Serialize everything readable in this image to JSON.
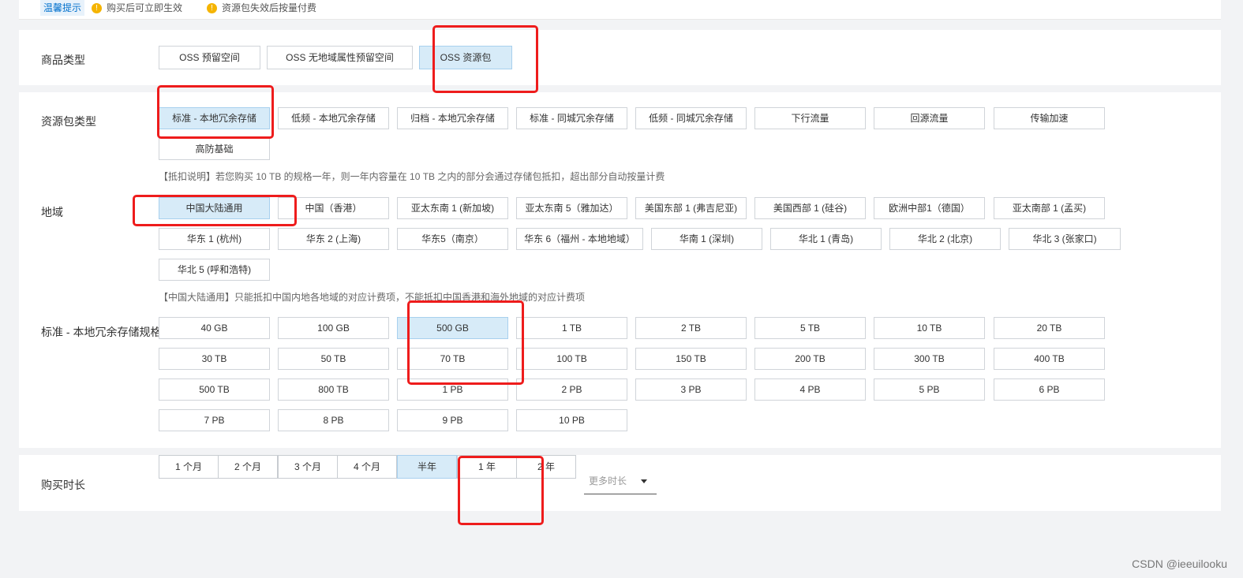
{
  "tips": {
    "tag": "温馨提示",
    "items": [
      "购买后可立即生效",
      "资源包失效后按量付费"
    ]
  },
  "product_type": {
    "label": "商品类型",
    "options": [
      "OSS 预留空间",
      "OSS 无地域属性预留空间",
      "OSS 资源包"
    ],
    "selected": "OSS 资源包"
  },
  "package_type": {
    "label": "资源包类型",
    "options": [
      "标准 - 本地冗余存储",
      "低频 - 本地冗余存储",
      "归档 - 本地冗余存储",
      "标准 - 同城冗余存储",
      "低频 - 同城冗余存储",
      "下行流量",
      "回源流量",
      "传输加速",
      "高防基础"
    ],
    "selected": "标准 - 本地冗余存储",
    "note": "【抵扣说明】若您购买 10 TB 的规格一年，则一年内容量在 10 TB 之内的部分会通过存储包抵扣，超出部分自动按量计费"
  },
  "region": {
    "label": "地域",
    "options": [
      "中国大陆通用",
      "中国（香港）",
      "亚太东南 1 (新加坡)",
      "亚太东南 5（雅加达）",
      "美国东部 1 (弗吉尼亚)",
      "美国西部 1 (硅谷)",
      "欧洲中部1（德国）",
      "亚太南部 1 (孟买)",
      "华东 1 (杭州)",
      "华东 2 (上海)",
      "华东5（南京）",
      "华东 6（福州 - 本地地域）",
      "华南 1 (深圳)",
      "华北 1 (青岛)",
      "华北 2 (北京)",
      "华北 3 (张家口)",
      "华北 5 (呼和浩特)"
    ],
    "selected": "中国大陆通用",
    "note": "【中国大陆通用】只能抵扣中国内地各地域的对应计费项，不能抵扣中国香港和海外地域的对应计费项"
  },
  "spec": {
    "label": "标准 - 本地冗余存储规格",
    "options": [
      "40 GB",
      "100 GB",
      "500 GB",
      "1 TB",
      "2 TB",
      "5 TB",
      "10 TB",
      "20 TB",
      "30 TB",
      "50 TB",
      "70 TB",
      "100 TB",
      "150 TB",
      "200 TB",
      "300 TB",
      "400 TB",
      "500 TB",
      "800 TB",
      "1 PB",
      "2 PB",
      "3 PB",
      "4 PB",
      "5 PB",
      "6 PB",
      "7 PB",
      "8 PB",
      "9 PB",
      "10 PB"
    ],
    "selected": "500 GB"
  },
  "duration": {
    "label": "购买时长",
    "options": [
      "1 个月",
      "2 个月",
      "3 个月",
      "4 个月",
      "半年",
      "1 年",
      "2 年"
    ],
    "selected": "半年",
    "more": "更多时长"
  },
  "watermark": "CSDN @ieeuilooku",
  "colors": {
    "selected_bg": "#d7ebf8",
    "annotation_red": "#ee1c1c"
  }
}
